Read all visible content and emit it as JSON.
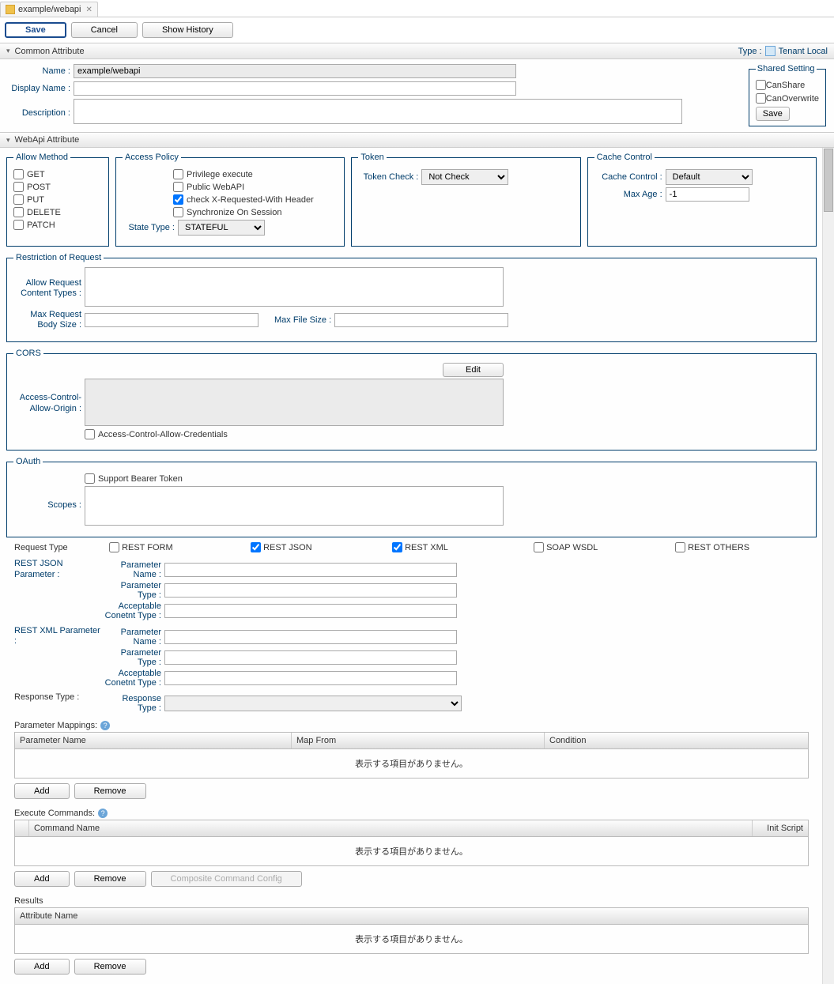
{
  "tab": {
    "label": "example/webapi"
  },
  "toolbar": {
    "save": "Save",
    "cancel": "Cancel",
    "history": "Show History"
  },
  "common": {
    "header": "Common Attribute",
    "typeLabel": "Type :",
    "typeValue": "Tenant Local",
    "name_l": "Name :",
    "name_v": "example/webapi",
    "display_l": "Display Name :",
    "display_v": "",
    "desc_l": "Description :",
    "desc_v": "",
    "shared": {
      "legend": "Shared Setting",
      "canShare": "CanShare",
      "canOverwrite": "CanOverwrite",
      "save": "Save"
    }
  },
  "webapi": {
    "header": "WebApi Attribute",
    "allow": {
      "legend": "Allow Method",
      "get": "GET",
      "post": "POST",
      "put": "PUT",
      "delete": "DELETE",
      "patch": "PATCH"
    },
    "access": {
      "legend": "Access Policy",
      "priv": "Privilege execute",
      "pub": "Public WebAPI",
      "xreq": "check X-Requested-With Header",
      "sync": "Synchronize On Session",
      "stateType_l": "State Type :",
      "stateType_v": "STATEFUL"
    },
    "token": {
      "legend": "Token",
      "check_l": "Token Check :",
      "check_v": "Not Check"
    },
    "cache": {
      "legend": "Cache Control",
      "cc_l": "Cache Control :",
      "cc_v": "Default",
      "maxage_l": "Max Age :",
      "maxage_v": "-1"
    },
    "restrict": {
      "legend": "Restriction of Request",
      "allowTypes_l": "Allow Request Content Types :",
      "maxBody_l": "Max Request Body Size :",
      "maxFile_l": "Max File Size :"
    },
    "cors": {
      "legend": "CORS",
      "edit": "Edit",
      "origin_l": "Access-Control-Allow-Origin :",
      "cred": "Access-Control-Allow-Credentials"
    },
    "oauth": {
      "legend": "OAuth",
      "bearer": "Support Bearer Token",
      "scopes_l": "Scopes :"
    }
  },
  "reqType": {
    "label": "Request Type",
    "restForm": "REST FORM",
    "restJson": "REST JSON",
    "restXml": "REST XML",
    "soap": "SOAP WSDL",
    "restOthers": "REST OTHERS"
  },
  "restJson": {
    "hdr": "REST JSON Parameter :",
    "pname": "Parameter Name :",
    "ptype": "Parameter Type :",
    "atype": "Acceptable Conetnt Type :"
  },
  "restXml": {
    "hdr": "REST XML Parameter :",
    "pname": "Parameter Name :",
    "ptype": "Parameter Type :",
    "atype": "Acceptable Conetnt Type :"
  },
  "respType": {
    "hdr": "Response Type :",
    "label": "Response Type :"
  },
  "paramMap": {
    "title": "Parameter Mappings:",
    "col1": "Parameter Name",
    "col2": "Map From",
    "col3": "Condition",
    "empty": "表示する項目がありません。",
    "add": "Add",
    "remove": "Remove"
  },
  "execCmd": {
    "title": "Execute Commands:",
    "col1": "Command Name",
    "col2": "Init Script",
    "empty": "表示する項目がありません。",
    "add": "Add",
    "remove": "Remove",
    "ccc": "Composite Command Config"
  },
  "results": {
    "title": "Results",
    "col1": "Attribute Name",
    "empty": "表示する項目がありません。",
    "add": "Add",
    "remove": "Remove"
  }
}
